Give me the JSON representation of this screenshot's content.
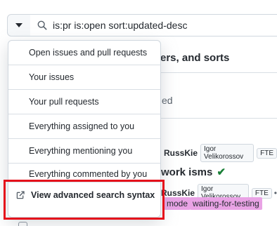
{
  "search": {
    "filter_button_icon": "caret-down-icon",
    "search_icon": "search-icon",
    "value": "is:pr is:open sort:updated-desc"
  },
  "menu": {
    "items": [
      {
        "label": "Open issues and pull requests"
      },
      {
        "label": "Your issues"
      },
      {
        "label": "Your pull requests"
      },
      {
        "label": "Everything assigned to you"
      },
      {
        "label": "Everything mentioning you"
      },
      {
        "label": "Everything commented by you"
      }
    ],
    "advanced": {
      "label": "View advanced search syntax",
      "icon": "external-link-icon"
    }
  },
  "background": {
    "heading": "ers, and sorts",
    "ed_text": "ed",
    "row1": {
      "author": "RussKie",
      "chip1": "Igor Velikorossov",
      "chip2": "FTE"
    },
    "pr_title": "work isms",
    "row2": {
      "author": "RussKie",
      "chip1": "Igor Velikorossov",
      "chip2": "FTE",
      "dot": "•"
    },
    "labels": [
      "mode",
      "waiting-for-testing"
    ]
  },
  "colors": {
    "highlight": "#e5101b",
    "label_pink": "#e9a3e5",
    "check_green": "#1a7f37"
  }
}
